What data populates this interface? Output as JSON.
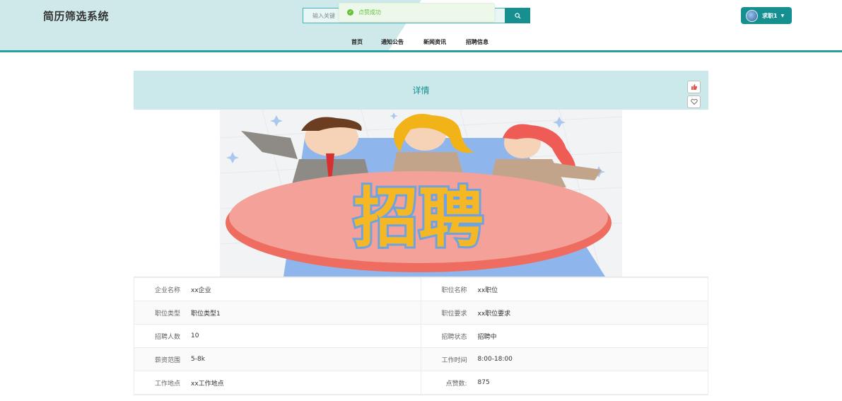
{
  "header": {
    "title": "简历筛选系统",
    "search_placeholder": "输入关键",
    "search_icon": "search-icon"
  },
  "toast": {
    "message": "点赞成功",
    "icon": "check-circle-icon",
    "color": "#67c23a"
  },
  "nav": {
    "items": [
      {
        "label": "首页"
      },
      {
        "label": "通知公告"
      },
      {
        "label": "新闻资讯"
      },
      {
        "label": "招聘信息"
      }
    ]
  },
  "user": {
    "name": "求职1",
    "icon": "avatar"
  },
  "detail": {
    "title": "详情",
    "like_icon": "thumbs-up-icon",
    "fav_icon": "heart-icon",
    "banner_text": "招聘",
    "fields": [
      [
        {
          "label": "企业名称",
          "value": "xx企业"
        },
        {
          "label": "职位名称",
          "value": "xx职位"
        }
      ],
      [
        {
          "label": "职位类型",
          "value": "职位类型1"
        },
        {
          "label": "职位要求",
          "value": "xx职位要求"
        }
      ],
      [
        {
          "label": "招聘人数",
          "value": "10"
        },
        {
          "label": "招聘状态",
          "value": "招聘中"
        }
      ],
      [
        {
          "label": "薪资范围",
          "value": "5-8k"
        },
        {
          "label": "工作时间",
          "value": "8:00-18:00"
        }
      ],
      [
        {
          "label": "工作地点",
          "value": "xx工作地点"
        },
        {
          "label": "点赞数:",
          "value": "875"
        }
      ]
    ]
  },
  "colors": {
    "primary": "#168f90",
    "header_tint": "#cfe9ea",
    "card_head": "#cbe8ea"
  }
}
